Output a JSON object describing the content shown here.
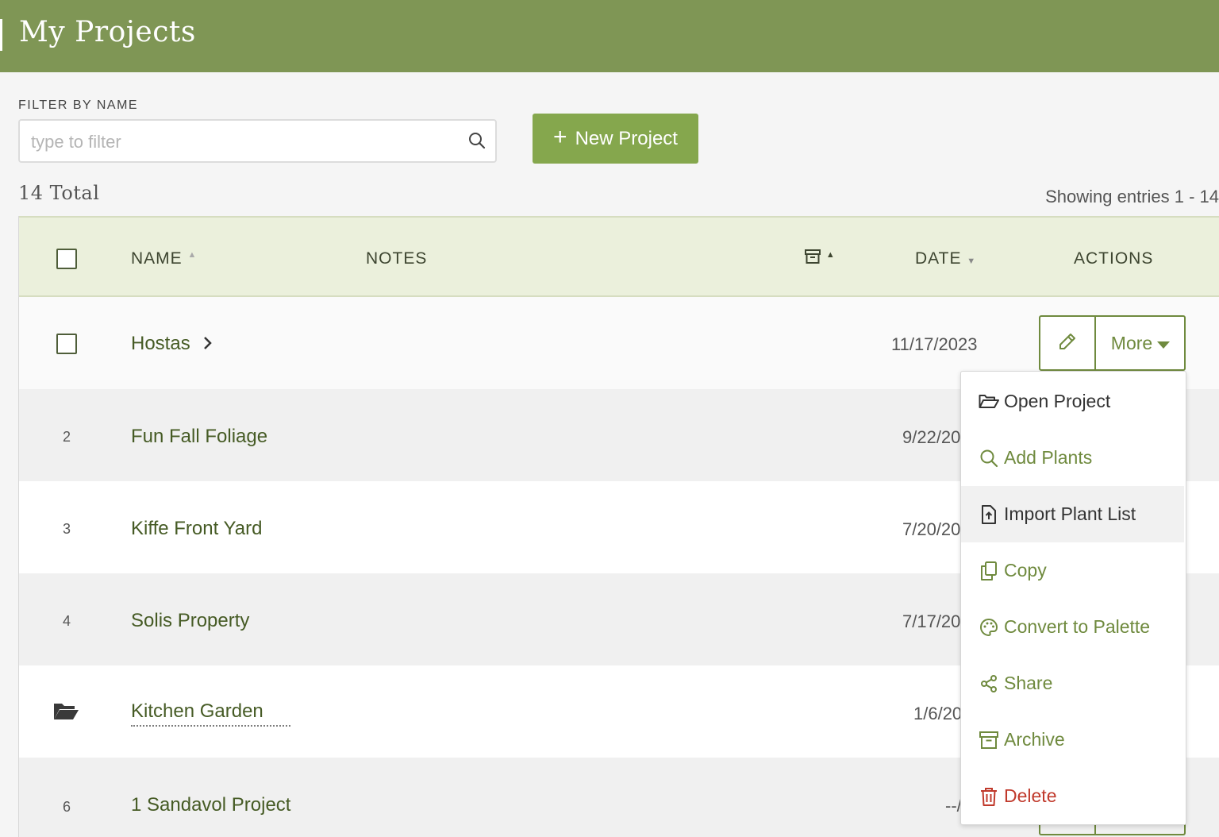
{
  "header": {
    "title": "My Projects"
  },
  "filter": {
    "label": "FILTER BY NAME",
    "placeholder": "type to filter",
    "value": ""
  },
  "new_project_label": "New Project",
  "summary": {
    "total": "14 Total",
    "showing": "Showing entries 1 - 14"
  },
  "table": {
    "columns": {
      "name": "NAME",
      "notes": "NOTES",
      "date": "DATE",
      "actions": "ACTIONS"
    },
    "rows": [
      {
        "num": "",
        "name": "Hostas",
        "date": "11/17/2023"
      },
      {
        "num": "2",
        "name": "Fun Fall Foliage",
        "date": "9/22/20"
      },
      {
        "num": "3",
        "name": "Kiffe Front Yard",
        "date": "7/20/20"
      },
      {
        "num": "4",
        "name": "Solis Property",
        "date": "7/17/20"
      },
      {
        "num": "",
        "name": "Kitchen Garden",
        "date": "1/6/20"
      },
      {
        "num": "6",
        "name": "1 Sandavol Project",
        "date": "--/"
      }
    ]
  },
  "actions": {
    "more_label": "More"
  },
  "menu": {
    "items": [
      {
        "label": "Open Project",
        "icon": "folder-open-icon"
      },
      {
        "label": "Add Plants",
        "icon": "search-icon"
      },
      {
        "label": "Import Plant List",
        "icon": "file-import-icon"
      },
      {
        "label": "Copy",
        "icon": "copy-icon"
      },
      {
        "label": "Convert to Palette",
        "icon": "palette-icon"
      },
      {
        "label": "Share",
        "icon": "share-icon"
      },
      {
        "label": "Archive",
        "icon": "archive-icon"
      },
      {
        "label": "Delete",
        "icon": "trash-icon"
      }
    ]
  },
  "colors": {
    "header": "#7f9655",
    "accent": "#85a74d",
    "danger": "#c0392b",
    "table_head": "#ebf0dc"
  }
}
